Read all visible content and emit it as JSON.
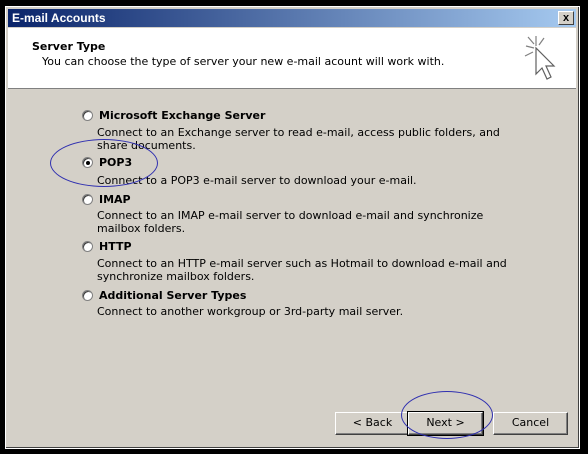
{
  "window": {
    "title": "E-mail Accounts",
    "close_label": "x"
  },
  "header": {
    "title": "Server Type",
    "subtitle": "You can choose the type of server your new e-mail acount will work with."
  },
  "options": [
    {
      "label": "Microsoft Exchange Server",
      "description": "Connect to an Exchange server to read e-mail, access public folders, and share documents.",
      "checked": false
    },
    {
      "label": "POP3",
      "description": "Connect to a POP3 e-mail server to download your e-mail.",
      "checked": true
    },
    {
      "label": "IMAP",
      "description": "Connect to an IMAP e-mail server to download e-mail and synchronize mailbox folders.",
      "checked": false
    },
    {
      "label": "HTTP",
      "description": "Connect to an HTTP e-mail server such as Hotmail to download e-mail and synchronize mailbox folders.",
      "checked": false
    },
    {
      "label": "Additional Server Types",
      "description": "Connect to another workgroup or 3rd-party mail server.",
      "checked": false
    }
  ],
  "buttons": {
    "back": "< Back",
    "next": "Next >",
    "cancel": "Cancel"
  }
}
